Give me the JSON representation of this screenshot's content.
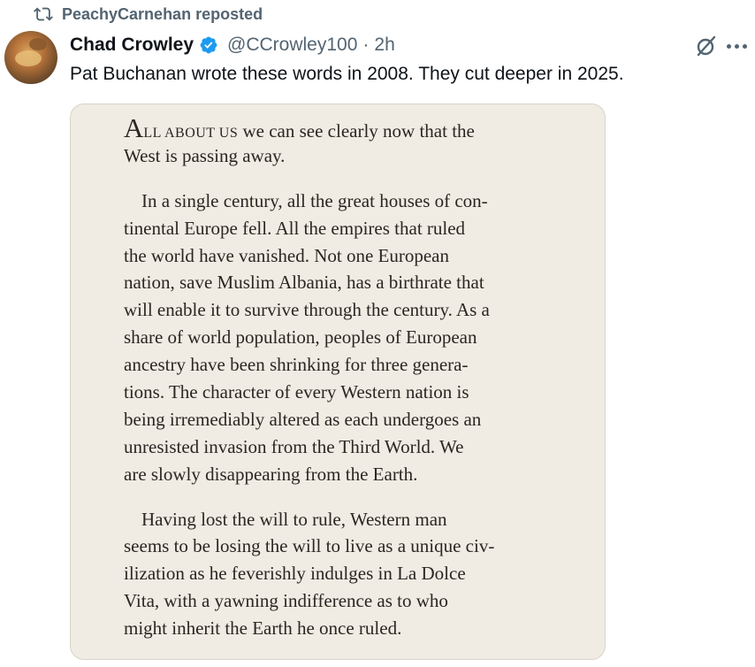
{
  "repost": {
    "icon": "repost-icon",
    "text": "PeachyCarnehan reposted"
  },
  "post": {
    "avatar_icon": "avatar",
    "display_name": "Chad Crowley",
    "verified_icon": "verified-badge-icon",
    "handle": "@CCrowley100",
    "separator": "·",
    "time": "2h",
    "text": "Pat Buchanan wrote these words in 2008. They cut deeper in 2025.",
    "actions": {
      "grok_icon": "grok-icon",
      "more_icon": "more-icon"
    }
  },
  "image": {
    "dropcap": "A",
    "smallcaps": "LL ABOUT US",
    "paragraphs": [
      {
        "lines": [
          " we can see clearly now that the",
          "West is passing away."
        ]
      },
      {
        "lines": [
          "In a single century, all the great houses of con-",
          "tinental Europe fell. All the empires that ruled",
          "the world have vanished. Not one European",
          "nation, save Muslim Albania, has a birthrate that",
          "will enable it to survive through the century. As a",
          "share of world population, peoples of European",
          "ancestry have been shrinking for three genera-",
          "tions. The character of every Western nation is",
          "being irremediably altered as each undergoes an",
          "unresisted invasion from the Third World. We",
          "are slowly disappearing from the Earth."
        ]
      },
      {
        "lines": [
          "Having lost the will to rule, Western man",
          "seems to be losing the will to live as a unique civ-",
          "ilization as he feverishly indulges in La Dolce",
          "Vita, with a yawning indifference as to who",
          "might inherit the Earth he once ruled."
        ]
      }
    ]
  },
  "colors": {
    "secondary_text": "#536471",
    "verified_blue": "#1d9bf0",
    "page_background": "#f0ece3"
  }
}
